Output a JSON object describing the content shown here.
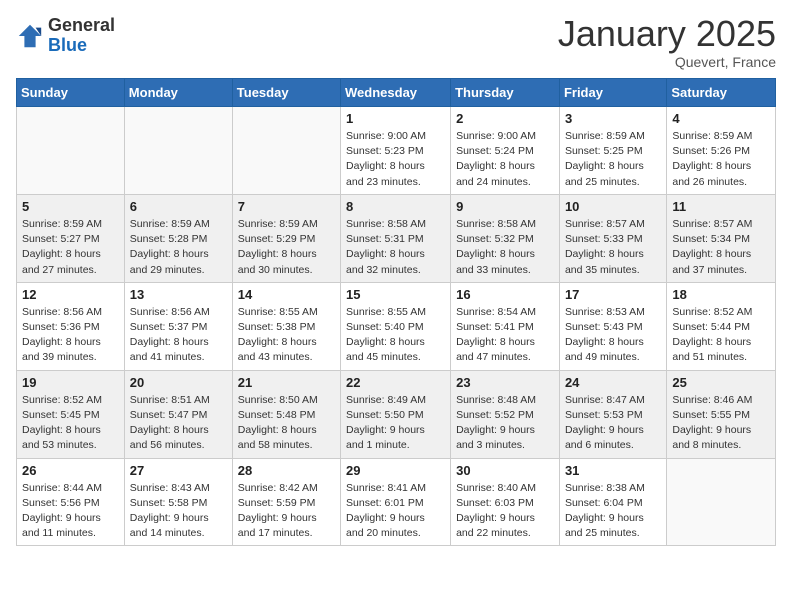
{
  "header": {
    "logo_general": "General",
    "logo_blue": "Blue",
    "month": "January 2025",
    "location": "Quevert, France"
  },
  "days_of_week": [
    "Sunday",
    "Monday",
    "Tuesday",
    "Wednesday",
    "Thursday",
    "Friday",
    "Saturday"
  ],
  "weeks": [
    [
      {
        "day": "",
        "info": ""
      },
      {
        "day": "",
        "info": ""
      },
      {
        "day": "",
        "info": ""
      },
      {
        "day": "1",
        "info": "Sunrise: 9:00 AM\nSunset: 5:23 PM\nDaylight: 8 hours\nand 23 minutes."
      },
      {
        "day": "2",
        "info": "Sunrise: 9:00 AM\nSunset: 5:24 PM\nDaylight: 8 hours\nand 24 minutes."
      },
      {
        "day": "3",
        "info": "Sunrise: 8:59 AM\nSunset: 5:25 PM\nDaylight: 8 hours\nand 25 minutes."
      },
      {
        "day": "4",
        "info": "Sunrise: 8:59 AM\nSunset: 5:26 PM\nDaylight: 8 hours\nand 26 minutes."
      }
    ],
    [
      {
        "day": "5",
        "info": "Sunrise: 8:59 AM\nSunset: 5:27 PM\nDaylight: 8 hours\nand 27 minutes."
      },
      {
        "day": "6",
        "info": "Sunrise: 8:59 AM\nSunset: 5:28 PM\nDaylight: 8 hours\nand 29 minutes."
      },
      {
        "day": "7",
        "info": "Sunrise: 8:59 AM\nSunset: 5:29 PM\nDaylight: 8 hours\nand 30 minutes."
      },
      {
        "day": "8",
        "info": "Sunrise: 8:58 AM\nSunset: 5:31 PM\nDaylight: 8 hours\nand 32 minutes."
      },
      {
        "day": "9",
        "info": "Sunrise: 8:58 AM\nSunset: 5:32 PM\nDaylight: 8 hours\nand 33 minutes."
      },
      {
        "day": "10",
        "info": "Sunrise: 8:57 AM\nSunset: 5:33 PM\nDaylight: 8 hours\nand 35 minutes."
      },
      {
        "day": "11",
        "info": "Sunrise: 8:57 AM\nSunset: 5:34 PM\nDaylight: 8 hours\nand 37 minutes."
      }
    ],
    [
      {
        "day": "12",
        "info": "Sunrise: 8:56 AM\nSunset: 5:36 PM\nDaylight: 8 hours\nand 39 minutes."
      },
      {
        "day": "13",
        "info": "Sunrise: 8:56 AM\nSunset: 5:37 PM\nDaylight: 8 hours\nand 41 minutes."
      },
      {
        "day": "14",
        "info": "Sunrise: 8:55 AM\nSunset: 5:38 PM\nDaylight: 8 hours\nand 43 minutes."
      },
      {
        "day": "15",
        "info": "Sunrise: 8:55 AM\nSunset: 5:40 PM\nDaylight: 8 hours\nand 45 minutes."
      },
      {
        "day": "16",
        "info": "Sunrise: 8:54 AM\nSunset: 5:41 PM\nDaylight: 8 hours\nand 47 minutes."
      },
      {
        "day": "17",
        "info": "Sunrise: 8:53 AM\nSunset: 5:43 PM\nDaylight: 8 hours\nand 49 minutes."
      },
      {
        "day": "18",
        "info": "Sunrise: 8:52 AM\nSunset: 5:44 PM\nDaylight: 8 hours\nand 51 minutes."
      }
    ],
    [
      {
        "day": "19",
        "info": "Sunrise: 8:52 AM\nSunset: 5:45 PM\nDaylight: 8 hours\nand 53 minutes."
      },
      {
        "day": "20",
        "info": "Sunrise: 8:51 AM\nSunset: 5:47 PM\nDaylight: 8 hours\nand 56 minutes."
      },
      {
        "day": "21",
        "info": "Sunrise: 8:50 AM\nSunset: 5:48 PM\nDaylight: 8 hours\nand 58 minutes."
      },
      {
        "day": "22",
        "info": "Sunrise: 8:49 AM\nSunset: 5:50 PM\nDaylight: 9 hours\nand 1 minute."
      },
      {
        "day": "23",
        "info": "Sunrise: 8:48 AM\nSunset: 5:52 PM\nDaylight: 9 hours\nand 3 minutes."
      },
      {
        "day": "24",
        "info": "Sunrise: 8:47 AM\nSunset: 5:53 PM\nDaylight: 9 hours\nand 6 minutes."
      },
      {
        "day": "25",
        "info": "Sunrise: 8:46 AM\nSunset: 5:55 PM\nDaylight: 9 hours\nand 8 minutes."
      }
    ],
    [
      {
        "day": "26",
        "info": "Sunrise: 8:44 AM\nSunset: 5:56 PM\nDaylight: 9 hours\nand 11 minutes."
      },
      {
        "day": "27",
        "info": "Sunrise: 8:43 AM\nSunset: 5:58 PM\nDaylight: 9 hours\nand 14 minutes."
      },
      {
        "day": "28",
        "info": "Sunrise: 8:42 AM\nSunset: 5:59 PM\nDaylight: 9 hours\nand 17 minutes."
      },
      {
        "day": "29",
        "info": "Sunrise: 8:41 AM\nSunset: 6:01 PM\nDaylight: 9 hours\nand 20 minutes."
      },
      {
        "day": "30",
        "info": "Sunrise: 8:40 AM\nSunset: 6:03 PM\nDaylight: 9 hours\nand 22 minutes."
      },
      {
        "day": "31",
        "info": "Sunrise: 8:38 AM\nSunset: 6:04 PM\nDaylight: 9 hours\nand 25 minutes."
      },
      {
        "day": "",
        "info": ""
      }
    ]
  ]
}
